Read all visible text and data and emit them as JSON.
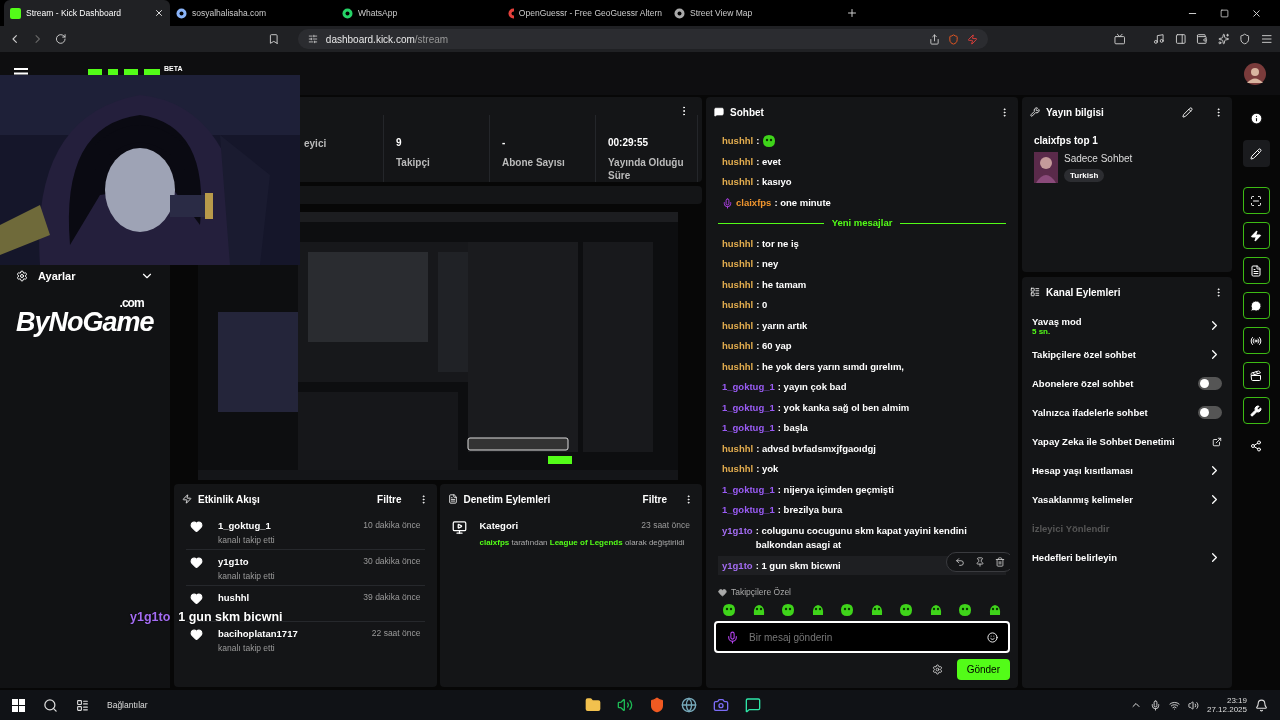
{
  "browser": {
    "tabs": [
      {
        "title": "Stream - Kick Dashboard",
        "selected": true,
        "kind": "kick"
      },
      {
        "title": "sosyalhalisaha.com",
        "selected": false,
        "kind": "site"
      },
      {
        "title": "WhatsApp",
        "selected": false,
        "kind": "whatsapp"
      },
      {
        "title": "OpenGuessr - Free GeoGuessr Altern",
        "selected": false,
        "kind": "target"
      },
      {
        "title": "Street View Map",
        "selected": false,
        "kind": "globe"
      }
    ],
    "url_host": "dashboard.kick.com",
    "url_path": "/stream"
  },
  "header": {
    "logo_badge": "BETA"
  },
  "sidebar": {
    "settings_label": "Ayarlar",
    "logo": "ByNoGame",
    "logo_suffix": ".com"
  },
  "stats": [
    {
      "label": "eyici"
    },
    {
      "value": "9",
      "label": "Takipçi"
    },
    {
      "value": "-",
      "label": "Abone Sayısı"
    },
    {
      "value": "00:29:55",
      "label": "Yayında Olduğu Süre"
    }
  ],
  "event_feed": {
    "title": "Etkinlik Akışı",
    "filter": "Filtre",
    "events": [
      {
        "user": "1_goktug_1",
        "action": "kanalı takip etti",
        "time": "10 dakika önce"
      },
      {
        "user": "y1g1to",
        "action": "kanalı takip etti",
        "time": "30 dakika önce"
      },
      {
        "user": "hushhl",
        "time": "39 dakika önce"
      },
      {
        "user": "bacihoplatan1717",
        "action": "kanalı takip etti",
        "time": "22 saat önce"
      }
    ]
  },
  "moderation": {
    "title": "Denetim Eylemleri",
    "filter": "Filtre",
    "actions": [
      {
        "title": "Kategori",
        "time": "23 saat önce",
        "parts": [
          {
            "text": "claixfps",
            "highlight": true
          },
          {
            "text": " tarafından ",
            "highlight": false
          },
          {
            "text": "League of Legends",
            "highlight": true
          },
          {
            "text": "  olarak değiştirildi",
            "highlight": false
          }
        ]
      }
    ]
  },
  "overlay_chat": {
    "user": "y1g1to",
    "message": "1 gun skm bicwni"
  },
  "chat": {
    "title": "Sohbet",
    "separator": ":",
    "messages": [
      {
        "kind": "emote",
        "user": "hushhl",
        "color": "#e3ad4f",
        "broadcaster": false,
        "hovered": false
      },
      {
        "kind": "text",
        "user": "hushhl",
        "color": "#e3ad4f",
        "text": "evet",
        "broadcaster": false,
        "hovered": false
      },
      {
        "kind": "text",
        "user": "hushhl",
        "color": "#e3ad4f",
        "text": "kasıyo",
        "broadcaster": false,
        "hovered": false
      },
      {
        "kind": "text",
        "user": "claixfps",
        "color": "#f0962e",
        "text": "one minute",
        "broadcaster": true,
        "hovered": false
      },
      {
        "kind": "divider",
        "text": "Yeni mesajlar"
      },
      {
        "kind": "text",
        "user": "hushhl",
        "color": "#e3ad4f",
        "text": "tor ne iş",
        "broadcaster": false,
        "hovered": false
      },
      {
        "kind": "text",
        "user": "hushhl",
        "color": "#e3ad4f",
        "text": "ney",
        "broadcaster": false,
        "hovered": false
      },
      {
        "kind": "text",
        "user": "hushhl",
        "color": "#e3ad4f",
        "text": "he tamam",
        "broadcaster": false,
        "hovered": false
      },
      {
        "kind": "text",
        "user": "hushhl",
        "color": "#e3ad4f",
        "text": "0",
        "broadcaster": false,
        "hovered": false
      },
      {
        "kind": "text",
        "user": "hushhl",
        "color": "#e3ad4f",
        "text": "yarın artık",
        "broadcaster": false,
        "hovered": false
      },
      {
        "kind": "text",
        "user": "hushhl",
        "color": "#e3ad4f",
        "text": "60 yap",
        "broadcaster": false,
        "hovered": false
      },
      {
        "kind": "text",
        "user": "hushhl",
        "color": "#e3ad4f",
        "text": "he yok ders yarın sımdı gırelım,",
        "broadcaster": false,
        "hovered": false
      },
      {
        "kind": "text",
        "user": "1_goktug_1",
        "color": "#9a5cf5",
        "text": "yayın çok bad",
        "broadcaster": false,
        "hovered": false
      },
      {
        "kind": "text",
        "user": "1_goktug_1",
        "color": "#9a5cf5",
        "text": "yok kanka sağ ol ben almim",
        "broadcaster": false,
        "hovered": false
      },
      {
        "kind": "text",
        "user": "1_goktug_1",
        "color": "#9a5cf5",
        "text": "başla",
        "broadcaster": false,
        "hovered": false
      },
      {
        "kind": "text",
        "user": "hushhl",
        "color": "#e3ad4f",
        "text": "advsd bvfadsmxjfgaoıdgj",
        "broadcaster": false,
        "hovered": false
      },
      {
        "kind": "text",
        "user": "hushhl",
        "color": "#e3ad4f",
        "text": "yok",
        "broadcaster": false,
        "hovered": false
      },
      {
        "kind": "text",
        "user": "1_goktug_1",
        "color": "#9a5cf5",
        "text": "nijerya içimden geçmişti",
        "broadcaster": false,
        "hovered": false
      },
      {
        "kind": "text",
        "user": "1_goktug_1",
        "color": "#9a5cf5",
        "text": "brezilya bura",
        "broadcaster": false,
        "hovered": false
      },
      {
        "kind": "text",
        "user": "y1g1to",
        "color": "#a36cf2",
        "text": "colugunu cocugunu skm kapat yayini kendini balkondan asagi at",
        "broadcaster": false,
        "hovered": false
      },
      {
        "kind": "text",
        "user": "y1g1to",
        "color": "#a36cf2",
        "text": "1 gun skm bicwni",
        "broadcaster": false,
        "hovered": true
      }
    ],
    "emote_section": "Takipçilere Özel",
    "placeholder": "Bir mesaj gönderin",
    "send": "Gönder"
  },
  "stream_info": {
    "title": "Yayın bilgisi",
    "stream_title": "claixfps top 1",
    "category": "Sadece Sohbet",
    "tag": "Turkish"
  },
  "channel_actions": {
    "title": "Kanal Eylemleri",
    "items": [
      {
        "kind": "link",
        "label": "Yavaş mod",
        "detail": "5 sn."
      },
      {
        "kind": "link",
        "label": "Takipçilere özel sohbet"
      },
      {
        "kind": "toggle",
        "label": "Abonelere özel sohbet",
        "on": false
      },
      {
        "kind": "toggle",
        "label": "Yalnızca ifadelerle sohbet",
        "on": false
      },
      {
        "kind": "external",
        "label": "Yapay Zeka ile Sohbet Denetimi"
      },
      {
        "kind": "link",
        "label": "Hesap yaşı kısıtlaması"
      },
      {
        "kind": "link",
        "label": "Yasaklanmış kelimeler"
      },
      {
        "kind": "section",
        "label": "İzleyici Yönlendir"
      },
      {
        "kind": "link",
        "label": "Hedefleri belirleyin"
      }
    ]
  },
  "taskbar": {
    "search_label": "Bağlantılar",
    "time": "23:19",
    "date": "27.12.2025"
  }
}
